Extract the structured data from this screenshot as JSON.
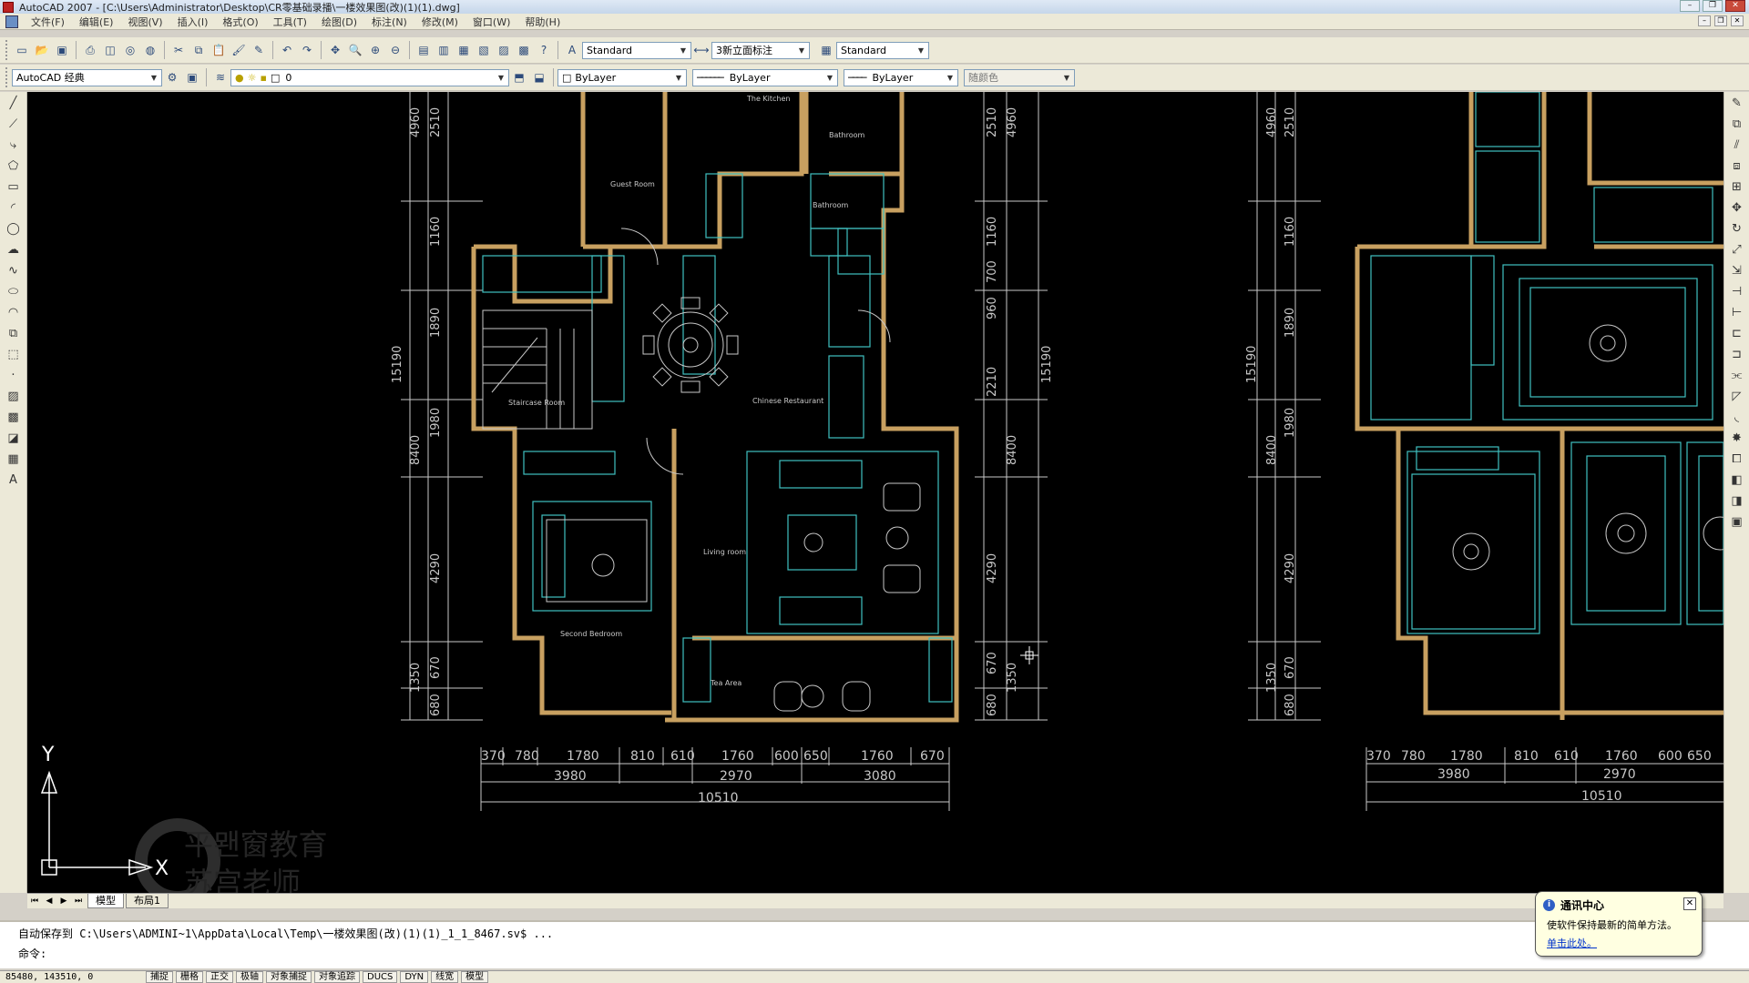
{
  "window": {
    "title": "AutoCAD 2007 - [C:\\Users\\Administrator\\Desktop\\CR零基础录播\\一楼效果图(改)(1)(1).dwg]"
  },
  "menu": [
    "文件(F)",
    "编辑(E)",
    "视图(V)",
    "插入(I)",
    "格式(O)",
    "工具(T)",
    "绘图(D)",
    "标注(N)",
    "修改(M)",
    "窗口(W)",
    "帮助(H)"
  ],
  "toolbar": {
    "text_style": "Standard",
    "dim_style": "3新立面标注",
    "table_style": "Standard",
    "workspace": "AutoCAD 经典",
    "layer": "0",
    "color": "ByLayer",
    "linetype": "ByLayer",
    "lineweight": "ByLayer",
    "plotstyle": "随颜色"
  },
  "drawing": {
    "rooms": [
      "The Kitchen",
      "Bathroom",
      "Guest Room",
      "Bathroom",
      "Staircase Room",
      "Chinese Restaurant",
      "Living room",
      "Second Bedroom",
      "Tea   Area"
    ],
    "left_dims": [
      "4960",
      "2510",
      "1160",
      "1890",
      "15190",
      "1980",
      "8400",
      "4290",
      "1350",
      "670",
      "680"
    ],
    "mid_dims": [
      "2510",
      "4960",
      "1160",
      "700",
      "960",
      "2210",
      "15190",
      "8400",
      "4290",
      "670",
      "1350",
      "680"
    ],
    "right_dims": [
      "4960",
      "2510",
      "1160",
      "1890",
      "15190",
      "1980",
      "8400",
      "4290",
      "1350",
      "670",
      "680"
    ],
    "bottom_dims_row1": [
      "370",
      "780",
      "1780",
      "810",
      "610",
      "1760",
      "600",
      "650",
      "1760",
      "670"
    ],
    "bottom_dims_row2": [
      "3980",
      "2970",
      "3080"
    ],
    "bottom_dims_total": "10510",
    "right_bottom_row1": [
      "370",
      "780",
      "1780",
      "810",
      "610",
      "1760",
      "600",
      "650"
    ],
    "right_bottom_row2": [
      "3980",
      "2970"
    ],
    "right_bottom_total": "10510",
    "ucs_y": "Y",
    "ucs_x": "X",
    "watermark_line1": "平뫤窗教育",
    "watermark_line2": "苏宫老师"
  },
  "tabs": [
    "模型",
    "布局1"
  ],
  "command": {
    "line1": "自动保存到 C:\\Users\\ADMINI~1\\AppData\\Local\\Temp\\一楼效果图(改)(1)(1)_1_1_8467.sv$ ...",
    "line2": "命令:"
  },
  "status": {
    "coords": "85480, 143510, 0",
    "buttons": [
      "捕捉",
      "栅格",
      "正交",
      "极轴",
      "对象捕捉",
      "对象追踪",
      "DUCS",
      "DYN",
      "线宽",
      "模型"
    ]
  },
  "balloon": {
    "title": "通讯中心",
    "message": "使软件保持最新的简单方法。",
    "link": "单击此处。"
  },
  "colors": {
    "canvas": "#000000",
    "wall": "#c8a060",
    "line_cyan": "#40c0c0",
    "dim": "#c8c8c8"
  }
}
